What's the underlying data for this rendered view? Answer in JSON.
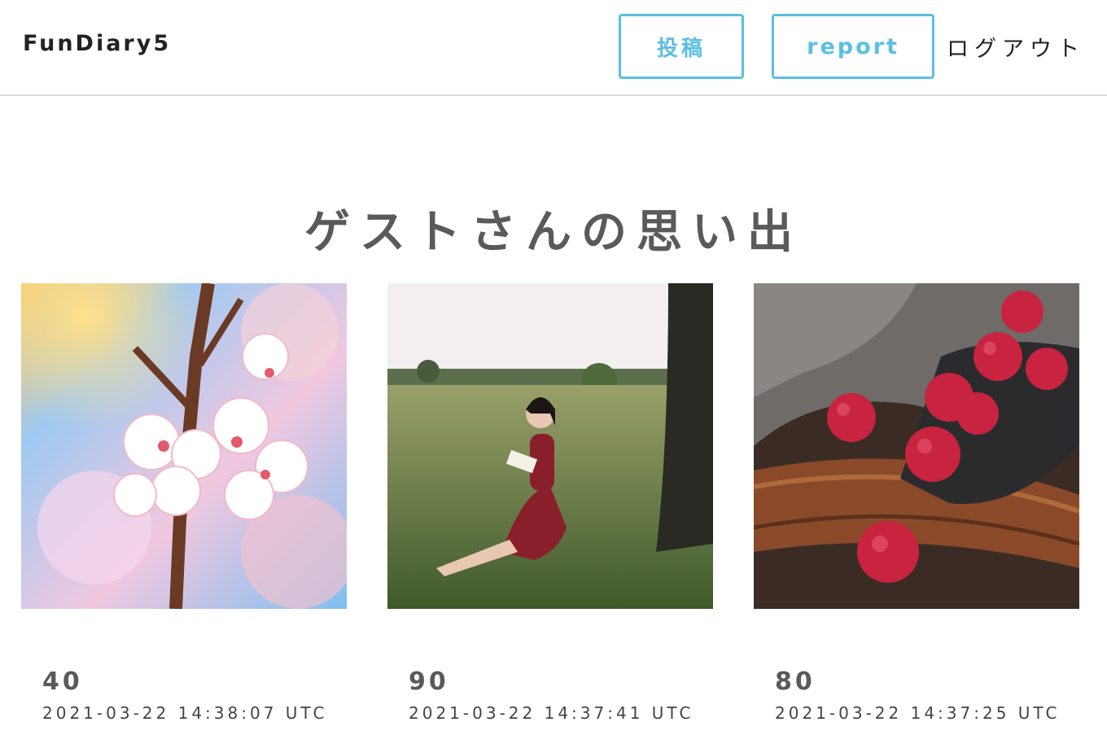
{
  "header": {
    "logo": "FunDiary5",
    "post_label": "投稿",
    "report_label": "report",
    "logout_label": "ログアウト"
  },
  "page_title": "ゲストさんの思い出",
  "accent_color": "#5bbfe2",
  "posts": [
    {
      "image": "cherry-blossom-photo",
      "score": "40",
      "date": "2021-03-22 14:38:07 UTC"
    },
    {
      "image": "girl-reading-in-field-photo",
      "score": "90",
      "date": "2021-03-22 14:37:41 UTC"
    },
    {
      "image": "raspberries-photo",
      "score": "80",
      "date": "2021-03-22 14:37:25 UTC"
    }
  ]
}
